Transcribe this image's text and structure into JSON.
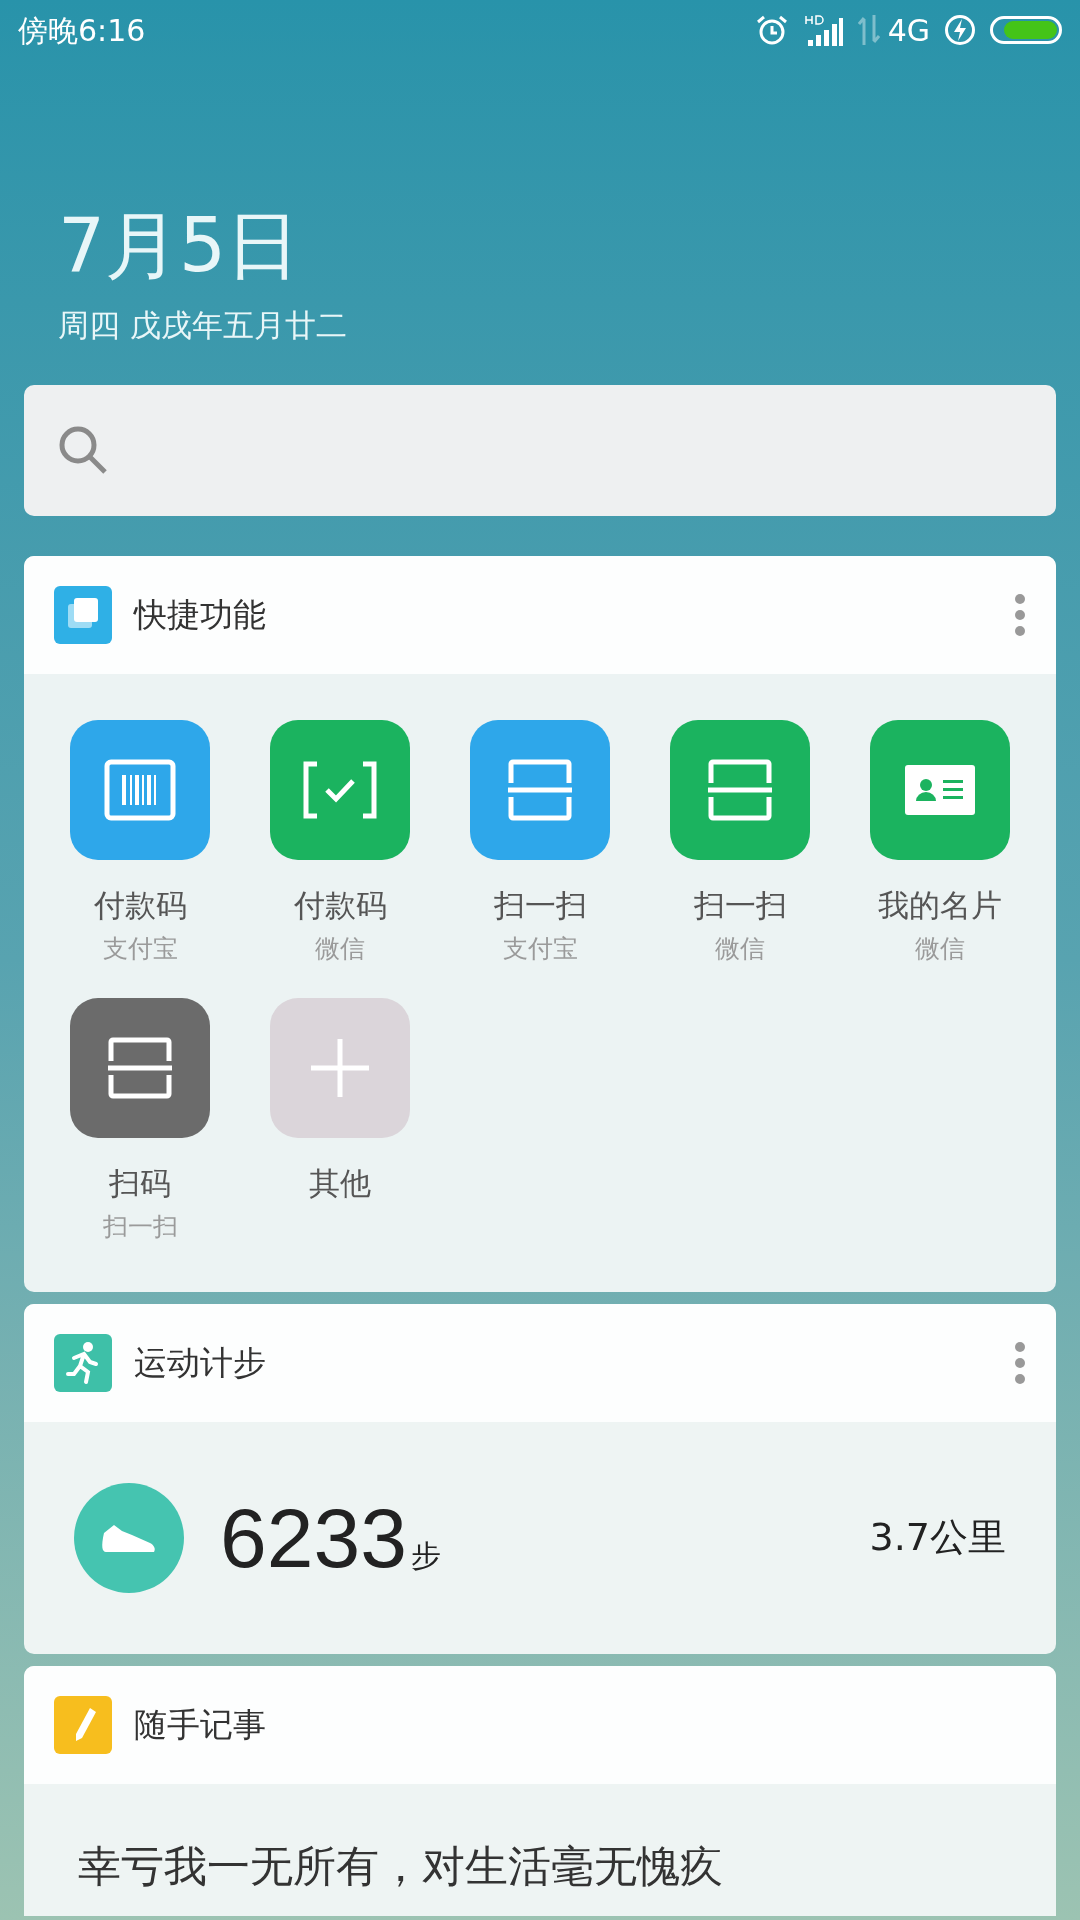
{
  "status_bar": {
    "time": "傍晚6:16",
    "network": "4G"
  },
  "date": {
    "day": "7月5日",
    "subtitle": "周四 戊戌年五月廿二"
  },
  "shortcuts": {
    "title": "快捷功能",
    "items": [
      {
        "label": "付款码",
        "sub": "支付宝",
        "kind": "barcode",
        "color": "#2ea7ea"
      },
      {
        "label": "付款码",
        "sub": "微信",
        "kind": "check",
        "color": "#1bb35f"
      },
      {
        "label": "扫一扫",
        "sub": "支付宝",
        "kind": "scan",
        "color": "#2ea7ea"
      },
      {
        "label": "扫一扫",
        "sub": "微信",
        "kind": "scan",
        "color": "#1bb35f"
      },
      {
        "label": "我的名片",
        "sub": "微信",
        "kind": "card",
        "color": "#1bb35f"
      },
      {
        "label": "扫码",
        "sub": "扫一扫",
        "kind": "scan",
        "color": "#6b6b6b"
      },
      {
        "label": "其他",
        "kind": "add",
        "color": "#dbd5da"
      }
    ]
  },
  "steps": {
    "title": "运动计步",
    "count": "6233",
    "unit": "步",
    "distance": "3.7公里"
  },
  "notes": {
    "title": "随手记事",
    "text": "幸亏我一无所有，对生活毫无愧疚"
  }
}
